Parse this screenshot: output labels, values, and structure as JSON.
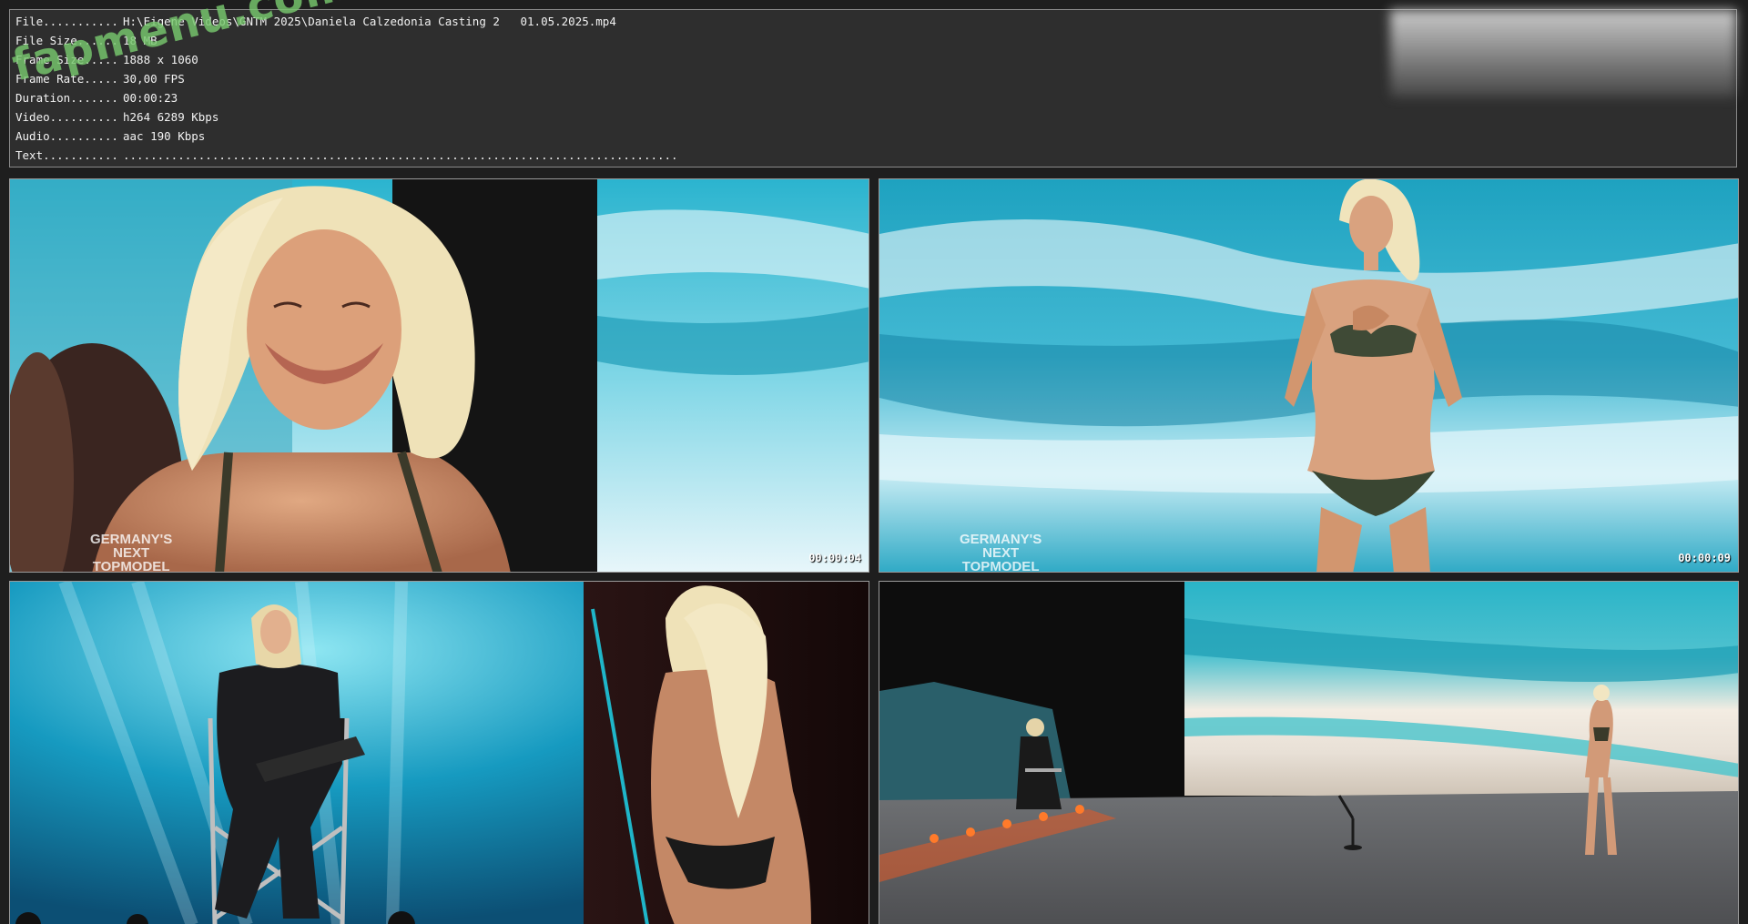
{
  "watermark": "fapmenu.com",
  "info": [
    {
      "key": "File...........",
      "value": "H:\\Eigene Videos\\GNTM 2025\\Daniela Calzedonia Casting 2   01.05.2025.mp4"
    },
    {
      "key": "File Size......",
      "value": "18 MB"
    },
    {
      "key": "Frame Size.....",
      "value": "1888 x 1060"
    },
    {
      "key": "Frame Rate.....",
      "value": "30,00 FPS"
    },
    {
      "key": "Duration.......",
      "value": "00:00:23"
    },
    {
      "key": "Video..........",
      "value": "h264 6289 Kbps"
    },
    {
      "key": "Audio..........",
      "value": "aac 190 Kbps"
    },
    {
      "key": "Text...........",
      "value": "................................................................................."
    }
  ],
  "frames": [
    {
      "timestamp": "00:00:04",
      "brand": [
        "GERMANY'S",
        "NEXT",
        "TOPMODEL"
      ]
    },
    {
      "timestamp": "00:00:09",
      "brand": [
        "GERMANY'S",
        "NEXT",
        "TOPMODEL"
      ]
    },
    {
      "timestamp": ""
    },
    {
      "timestamp": ""
    }
  ],
  "colors": {
    "panel": "#2e2e2e",
    "background": "#1e1e1e",
    "sea": "#1fa7c4"
  }
}
